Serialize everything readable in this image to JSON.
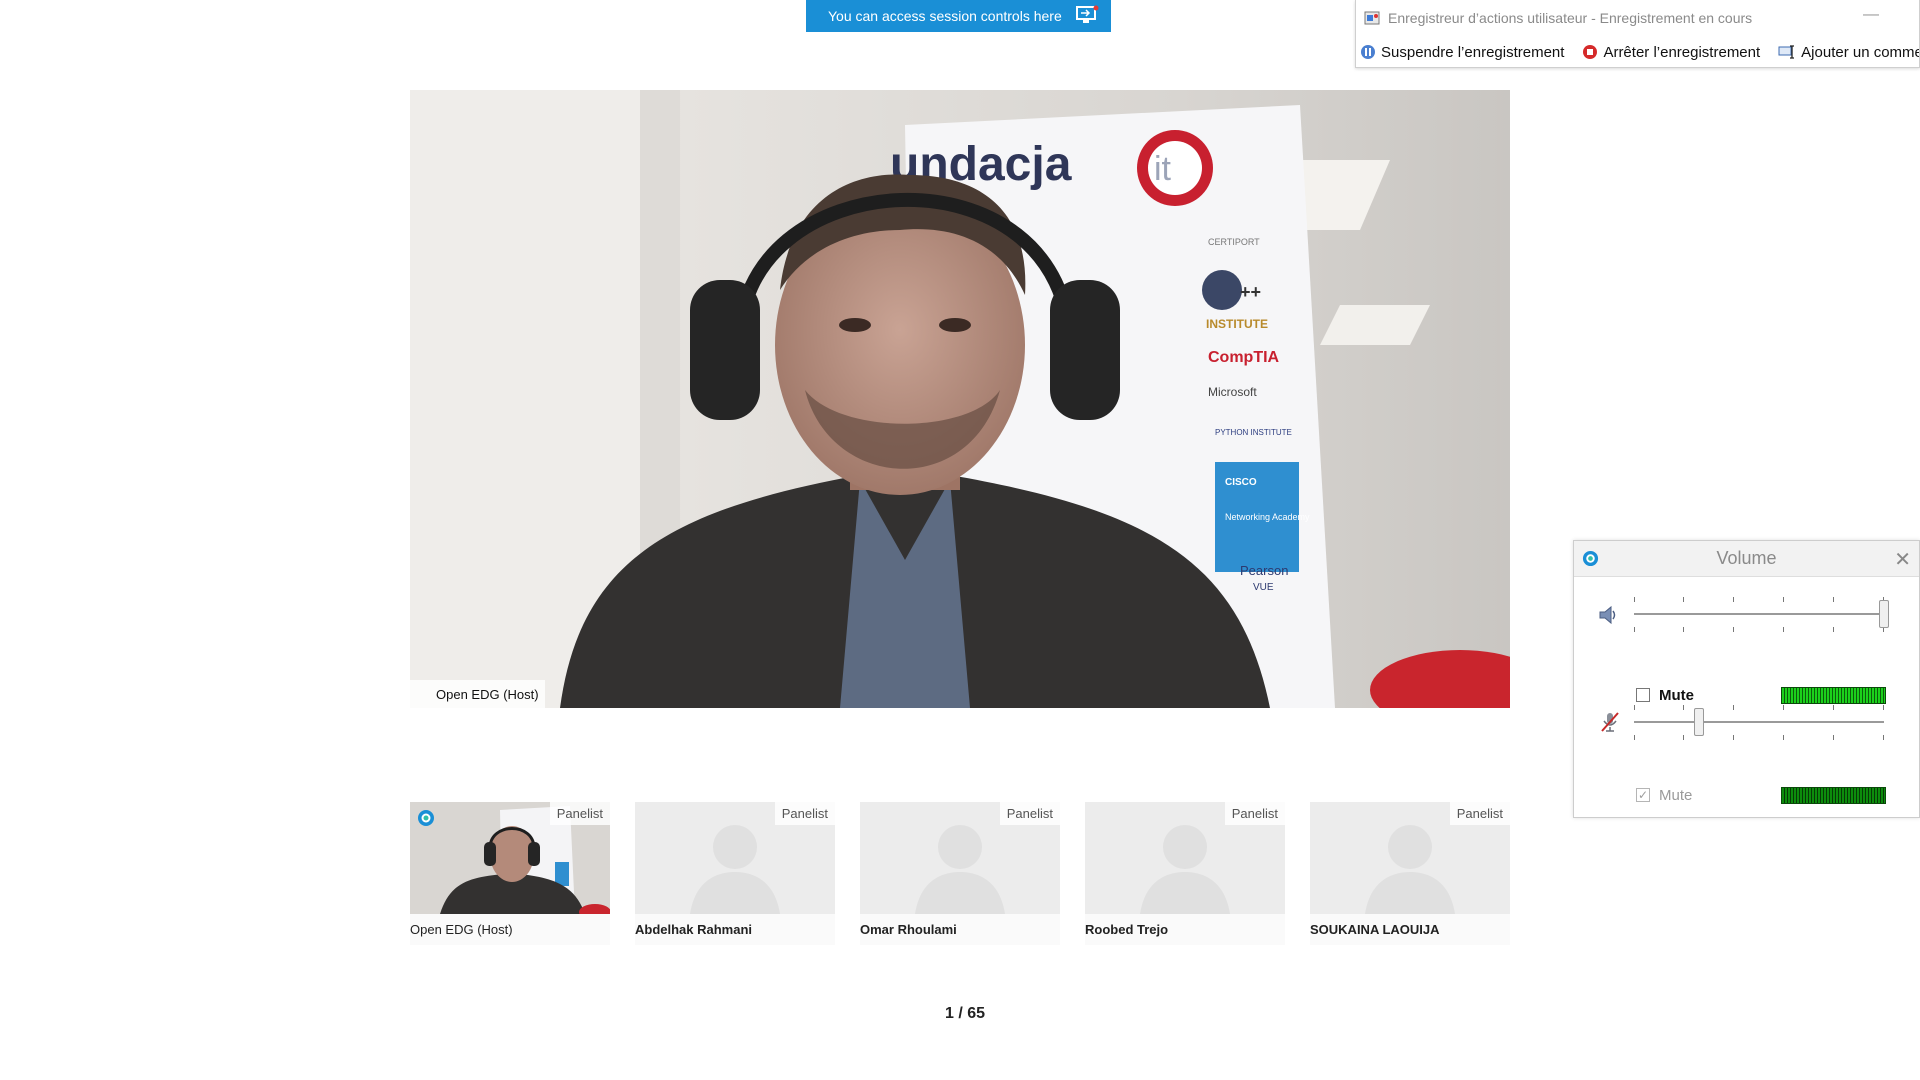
{
  "session_banner": {
    "text": "You can access session controls here",
    "icon": "screen-share-icon"
  },
  "recorder": {
    "title": "Enregistreur d’actions utilisateur - Enregistrement en cours",
    "minimize_glyph": "—",
    "buttons": {
      "pause": "Suspendre l’enregistrement",
      "stop": "Arrêter l’enregistrement",
      "comment": "Ajouter un comme"
    }
  },
  "main_video": {
    "host_label": "Open EDG (Host)",
    "banner_text": "undacja",
    "banner_logos": [
      "CERTIPORT",
      "++",
      "INSTITUTE",
      "CompTIA",
      "Microsoft",
      "PYTHON INSTITUTE",
      "CISCO",
      "Networking Academy",
      "Pearson",
      "VUE"
    ]
  },
  "thumbnails": [
    {
      "name": "Open EDG (Host)",
      "badge": "Panelist"
    },
    {
      "name": "Abdelhak Rahmani",
      "badge": "Panelist"
    },
    {
      "name": "Omar Rhoulami",
      "badge": "Panelist"
    },
    {
      "name": "Roobed Trejo",
      "badge": "Panelist"
    },
    {
      "name": "SOUKAINA LAOUIJA",
      "badge": "Panelist"
    }
  ],
  "pager": {
    "text": "1 / 65"
  },
  "volume": {
    "title": "Volume",
    "close_glyph": "✕",
    "speaker": {
      "mute_label": "Mute",
      "muted": false,
      "level": 1.0
    },
    "microphone": {
      "mute_label": "Mute",
      "muted": true,
      "level": 0.26
    }
  },
  "colors": {
    "banner_blue": "#1a8fd6",
    "meter_green": "#1bd01b"
  }
}
